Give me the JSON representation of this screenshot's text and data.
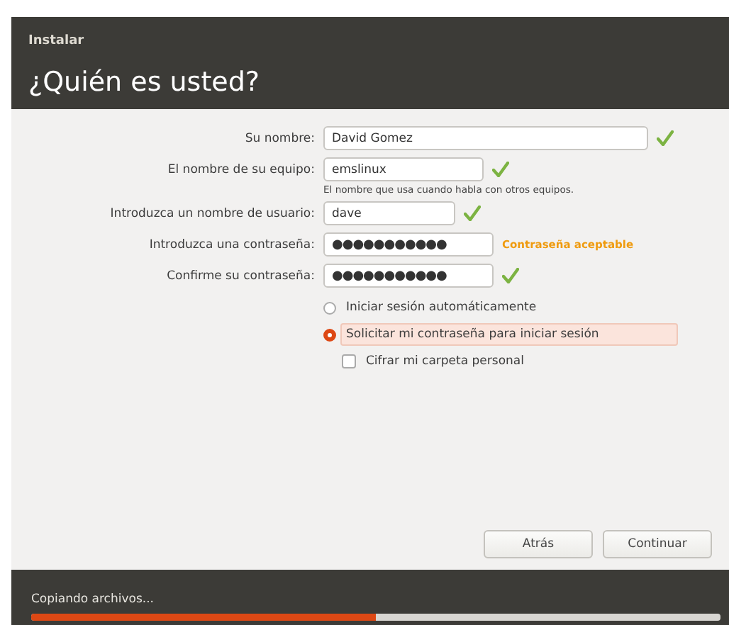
{
  "window": {
    "title": "Instalar"
  },
  "heading": "¿Quién es usted?",
  "fields": [
    {
      "label": "Su nombre:",
      "value": "David Gomez",
      "kind": "text",
      "feedback": {
        "kind": "check"
      }
    },
    {
      "label": "El nombre de su equipo:",
      "value": "emslinux",
      "kind": "text",
      "feedback": {
        "kind": "check"
      },
      "hint": "El nombre que usa cuando habla con otros equipos."
    },
    {
      "label": "Introduzca un nombre de usuario:",
      "value": "dave",
      "kind": "text",
      "feedback": {
        "kind": "check"
      }
    },
    {
      "label": "Introduzca una contraseña:",
      "value": "●●●●●●●●●●●",
      "kind": "password",
      "feedback": {
        "kind": "text",
        "text": "Contraseña aceptable"
      }
    },
    {
      "label": "Confirme su contraseña:",
      "value": "●●●●●●●●●●●",
      "kind": "password",
      "feedback": {
        "kind": "check"
      }
    }
  ],
  "options": [
    {
      "kind": "radio",
      "label": "Iniciar sesión automáticamente",
      "selected": false
    },
    {
      "kind": "radio",
      "label": "Solicitar mi contraseña para iniciar sesión",
      "selected": true
    },
    {
      "kind": "checkbox",
      "label": "Cifrar mi carpeta personal",
      "checked": false
    }
  ],
  "buttons": [
    "Atrás",
    "Continuar"
  ],
  "progress": {
    "label": "Copiando archivos...",
    "level": 0.5
  }
}
